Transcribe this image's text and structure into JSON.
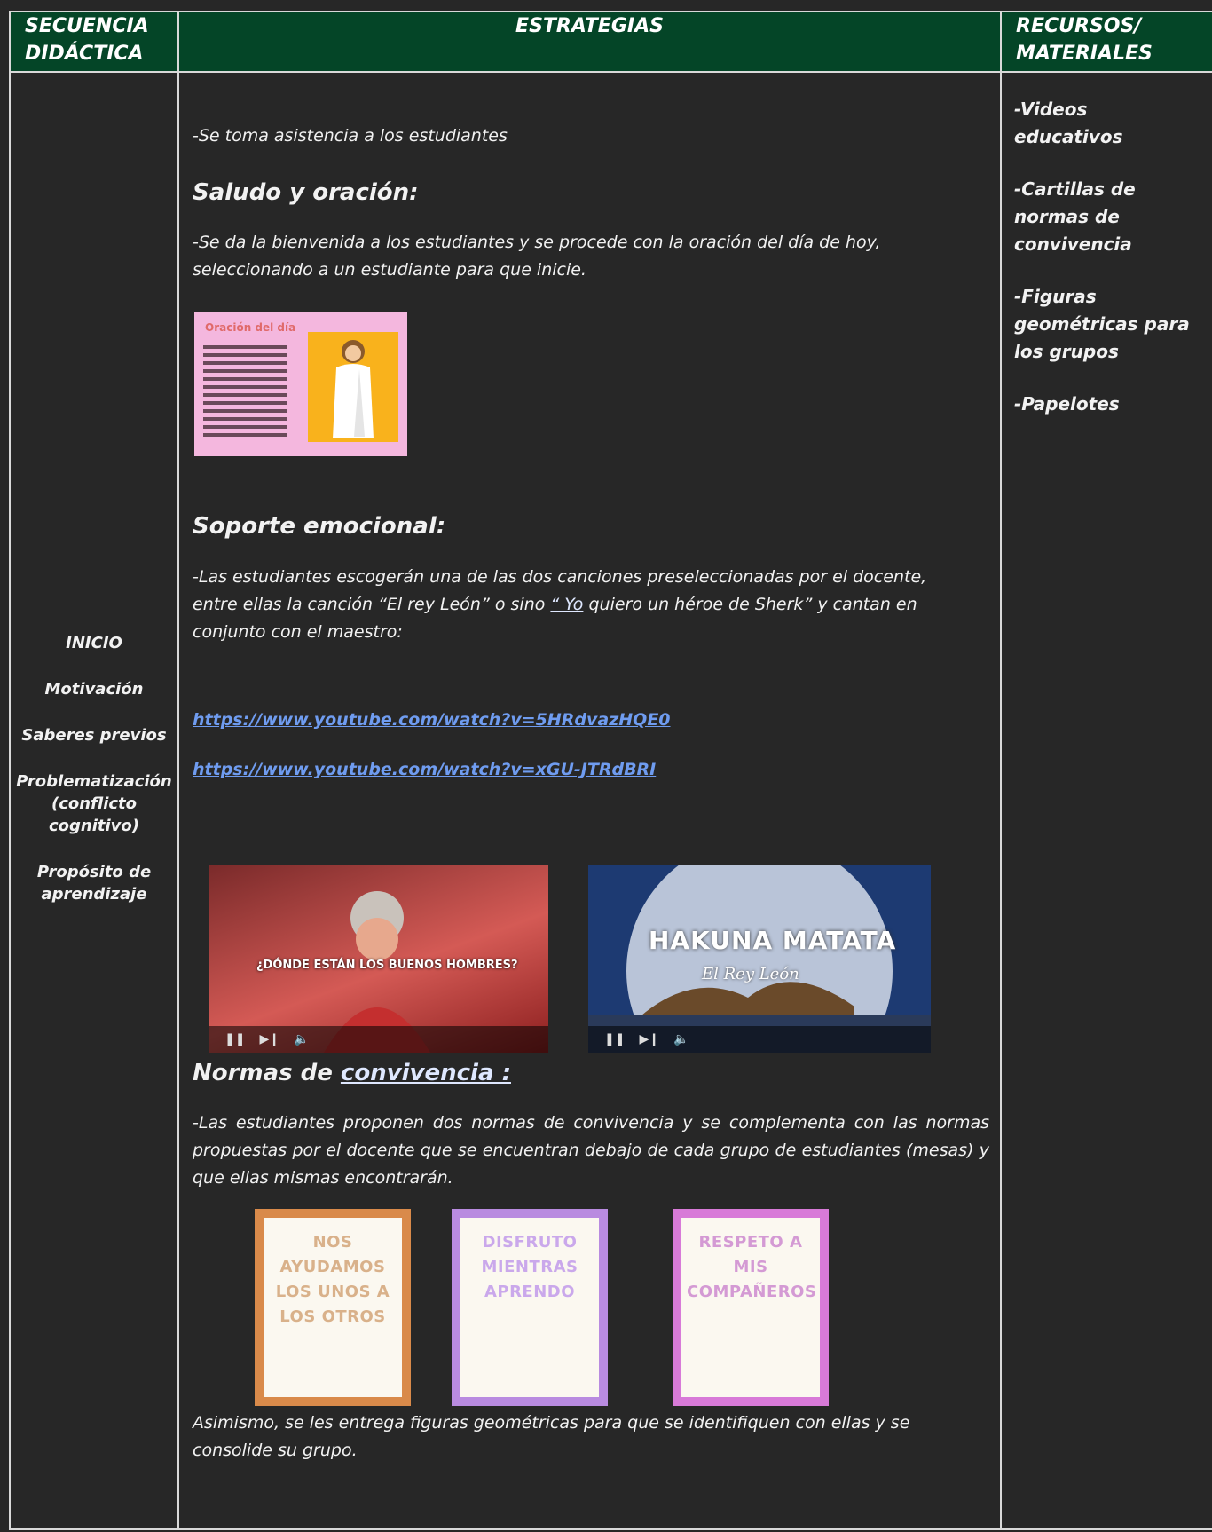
{
  "header": {
    "col1": "SECUENCIA DIDÁCTICA",
    "col1_line1": "SECUENCIA",
    "col1_line2": "DIDÁCTICA",
    "col2": "ESTRATEGIAS",
    "col3_line1": "RECURSOS/",
    "col3_line2": "MATERIALES"
  },
  "stages": [
    "INICIO",
    "Motivación",
    "Saberes previos",
    "Problematización (conflicto cognitivo)",
    "Propósito de aprendizaje"
  ],
  "strategies": {
    "attendance": "-Se toma asistencia a los estudiantes",
    "greeting_title": "Saludo y oración:",
    "greeting_text": "-Se da la bienvenida a los estudiantes y se procede con la oración del día de hoy, seleccionando a un estudiante para que inicie.",
    "prayer_card_title": "Oración del día",
    "emotional_title": "Soporte emocional:",
    "emotional_text_a": "-Las estudiantes escogerán una de las dos canciones preseleccionadas por el docente, entre ellas la canción “El rey León” o sino ",
    "emotional_text_u": "“ Yo",
    "emotional_text_b": " quiero un héroe de Sherk” y cantan en conjunto con el maestro:",
    "link1": "https://www.youtube.com/watch?v=5HRdvazHQE0",
    "link2": "https://www.youtube.com/watch?v=xGU-JTRdBRI",
    "video1_caption": "¿DÓNDE ESTÁN LOS BUENOS HOMBRES?",
    "video2_title": "HAKUNA MATATA",
    "video2_subtitle": "El Rey León",
    "norms_title_a": "Normas de ",
    "norms_title_u": "convivencia :",
    "norms_text": "-Las estudiantes proponen dos normas de convivencia y se complementa con las normas propuestas por el docente que se encuentran debajo de cada grupo de estudiantes (mesas) y que ellas mismas encontrarán.",
    "norm_cards": [
      "NOS AYUDAMOS LOS UNOS A LOS OTROS",
      "DISFRUTO MIENTRAS APRENDO",
      "RESPETO A MIS COMPAÑEROS"
    ],
    "closing_text": "Asimismo, se les entrega figuras geométricas para que se identifiquen con ellas y se consolide su grupo."
  },
  "resources": [
    "-Videos educativos",
    "-Cartillas de normas de convivencia",
    "-Figuras geométricas para los grupos",
    "-Papelotes"
  ],
  "colors": {
    "header_bg": "#044527",
    "page_bg": "#272727",
    "link": "#6f9cf0"
  }
}
